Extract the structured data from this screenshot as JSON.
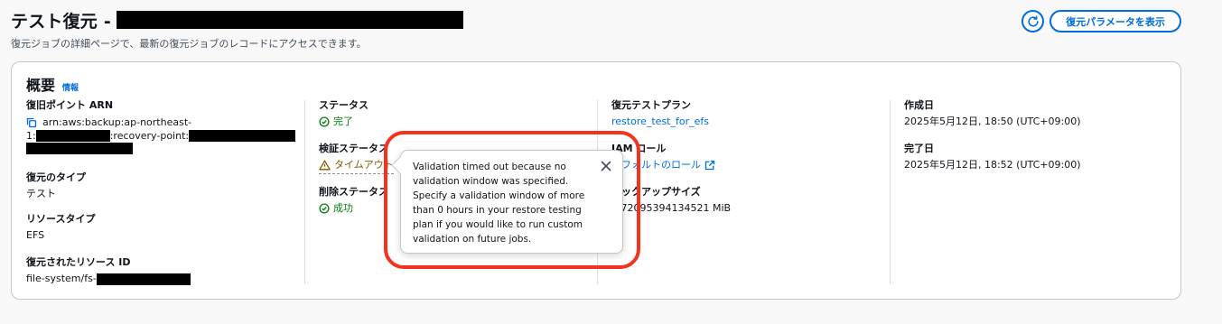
{
  "header": {
    "title": "テスト復元 -",
    "description": "復元ジョブの詳細ページで、最新の復元ジョブのレコードにアクセスできます。",
    "params_button": "復元パラメータを表示"
  },
  "overview": {
    "title": "概要",
    "info": "情報",
    "recovery_point": {
      "label": "復旧ポイント ARN",
      "line1": "arn:aws:backup:ap-northeast-",
      "line2a": "1:",
      "line2b": ":recovery-point:"
    },
    "restore_type": {
      "label": "復元のタイプ",
      "value": "テスト"
    },
    "resource_type": {
      "label": "リソースタイプ",
      "value": "EFS"
    },
    "restored_resource": {
      "label": "復元されたリソース ID",
      "value": "file-system/fs-"
    },
    "status": {
      "label": "ステータス",
      "value": "完了"
    },
    "validation_status": {
      "label": "検証ステータス",
      "value": "タイムアウト"
    },
    "deletion_status": {
      "label": "削除ステータス",
      "value": "成功"
    },
    "test_plan": {
      "label": "復元テストプラン",
      "value": "restore_test_for_efs"
    },
    "iam_role": {
      "label": "IAM ロール",
      "value": "デフォルトのロール"
    },
    "backup_size": {
      "label": "バックアップサイズ",
      "value": "0.72095394134521 MiB"
    },
    "created": {
      "label": "作成日",
      "value": "2025年5月12日, 18:50 (UTC+09:00)"
    },
    "completed": {
      "label": "完了日",
      "value": "2025年5月12日, 18:52 (UTC+09:00)"
    }
  },
  "popover": {
    "text": "Validation timed out because no validation window was specified. Specify a validation window of more than 0 hours in your restore testing plan if you would like to run custom validation on future jobs."
  },
  "colors": {
    "accent": "#006ce0",
    "success": "#037f0c",
    "warning": "#855900",
    "highlight": "#f3331f"
  }
}
